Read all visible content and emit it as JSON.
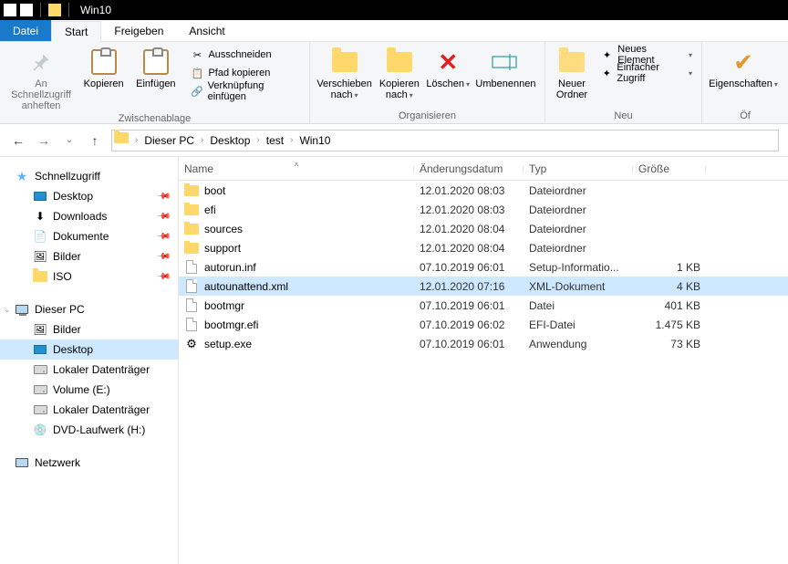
{
  "title": "Win10",
  "menutabs": {
    "file": "Datei",
    "start": "Start",
    "share": "Freigeben",
    "view": "Ansicht"
  },
  "ribbon": {
    "pin": "An Schnellzugriff\nanheften",
    "copy": "Kopieren",
    "paste": "Einfügen",
    "cut": "Ausschneiden",
    "copypath": "Pfad kopieren",
    "pastelink": "Verknüpfung einfügen",
    "clipboard_group": "Zwischenablage",
    "moveto": "Verschieben\nnach",
    "copyto": "Kopieren\nnach",
    "delete": "Löschen",
    "rename": "Umbenennen",
    "organize_group": "Organisieren",
    "newfolder": "Neuer\nOrdner",
    "newitem": "Neues Element",
    "easyaccess": "Einfacher Zugriff",
    "new_group": "Neu",
    "properties": "Eigenschaften",
    "open_group": "Öf"
  },
  "breadcrumbs": [
    "Dieser PC",
    "Desktop",
    "test",
    "Win10"
  ],
  "nav": {
    "quick": "Schnellzugriff",
    "quick_items": [
      "Desktop",
      "Downloads",
      "Dokumente",
      "Bilder",
      "ISO"
    ],
    "pc": "Dieser PC",
    "pc_items": [
      "Bilder",
      "Desktop",
      "Lokaler Datenträger",
      "Volume (E:)",
      "Lokaler Datenträger",
      "DVD-Laufwerk (H:)"
    ],
    "network": "Netzwerk"
  },
  "columns": {
    "name": "Name",
    "date": "Änderungsdatum",
    "type": "Typ",
    "size": "Größe"
  },
  "files": [
    {
      "icon": "folder",
      "name": "boot",
      "date": "12.01.2020 08:03",
      "type": "Dateiordner",
      "size": ""
    },
    {
      "icon": "folder",
      "name": "efi",
      "date": "12.01.2020 08:03",
      "type": "Dateiordner",
      "size": ""
    },
    {
      "icon": "folder",
      "name": "sources",
      "date": "12.01.2020 08:04",
      "type": "Dateiordner",
      "size": ""
    },
    {
      "icon": "folder",
      "name": "support",
      "date": "12.01.2020 08:04",
      "type": "Dateiordner",
      "size": ""
    },
    {
      "icon": "file",
      "name": "autorun.inf",
      "date": "07.10.2019 06:01",
      "type": "Setup-Informatio...",
      "size": "1 KB"
    },
    {
      "icon": "file",
      "name": "autounattend.xml",
      "date": "12.01.2020 07:16",
      "type": "XML-Dokument",
      "size": "4 KB",
      "selected": true
    },
    {
      "icon": "file",
      "name": "bootmgr",
      "date": "07.10.2019 06:01",
      "type": "Datei",
      "size": "401 KB"
    },
    {
      "icon": "file",
      "name": "bootmgr.efi",
      "date": "07.10.2019 06:02",
      "type": "EFI-Datei",
      "size": "1.475 KB"
    },
    {
      "icon": "exe",
      "name": "setup.exe",
      "date": "07.10.2019 06:01",
      "type": "Anwendung",
      "size": "73 KB"
    }
  ]
}
